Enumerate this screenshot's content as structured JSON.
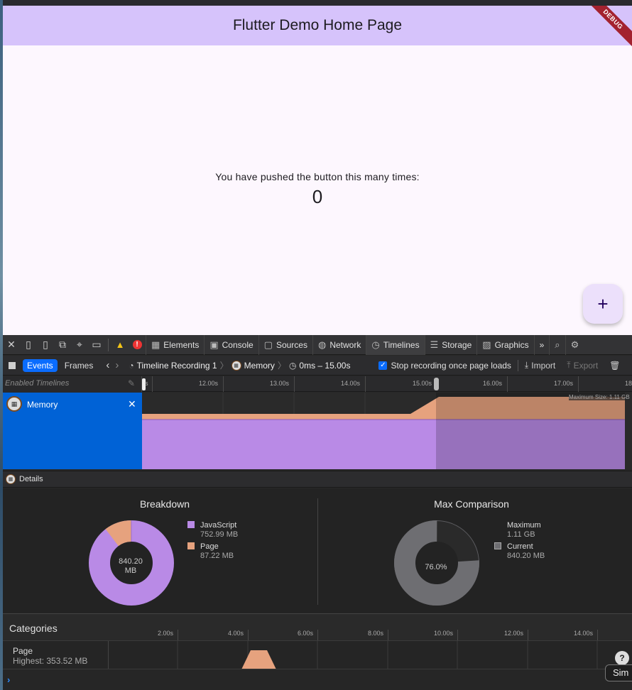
{
  "app": {
    "title": "Flutter Demo Home Page",
    "debug_banner": "DEBUG",
    "counter_label": "You have pushed the button this many times:",
    "counter_value": "0",
    "fab_label": "+"
  },
  "devtools": {
    "tabs": [
      {
        "label": "Elements",
        "icon": "elements-icon"
      },
      {
        "label": "Console",
        "icon": "console-icon"
      },
      {
        "label": "Sources",
        "icon": "sources-icon"
      },
      {
        "label": "Network",
        "icon": "network-icon"
      },
      {
        "label": "Timelines",
        "icon": "timelines-icon",
        "active": true
      },
      {
        "label": "Storage",
        "icon": "storage-icon"
      },
      {
        "label": "Graphics",
        "icon": "graphics-icon"
      }
    ],
    "more_tabs": "»",
    "toolbar": {
      "events_label": "Events",
      "frames_label": "Frames",
      "recording_label": "Timeline Recording 1",
      "memory_label": "Memory",
      "range_label": "0ms – 15.00s",
      "stop_recording_label": "Stop recording once page loads",
      "import_label": "Import",
      "export_label": "Export"
    },
    "ruler": {
      "enabled_label": "Enabled Timelines",
      "ticks": [
        "s",
        "12.00s",
        "13.00s",
        "14.00s",
        "15.00s",
        "16.00s",
        "17.00s",
        "18"
      ]
    },
    "memory_track": {
      "label": "Memory",
      "max_size_label": "Maximum Size: 1.11 GB"
    },
    "details_label": "Details",
    "breakdown": {
      "title": "Breakdown",
      "center_value": "840.20",
      "center_unit": "MB",
      "items": [
        {
          "name": "JavaScript",
          "value": "752.99 MB",
          "color": "#b98ae6"
        },
        {
          "name": "Page",
          "value": "87.22 MB",
          "color": "#e6a27e"
        }
      ]
    },
    "max_comparison": {
      "title": "Max Comparison",
      "center_value": "76.0%",
      "percent": 76.0,
      "items": [
        {
          "name": "Maximum",
          "value": "1.11 GB"
        },
        {
          "name": "Current",
          "value": "840.20 MB",
          "color": "#6e6e72"
        }
      ]
    },
    "categories": {
      "title": "Categories",
      "ticks": [
        "2.00s",
        "4.00s",
        "6.00s",
        "8.00s",
        "10.00s",
        "12.00s",
        "14.00s"
      ],
      "rows": [
        {
          "name": "Page",
          "highest": "Highest: 353.52 MB"
        }
      ]
    },
    "help_label": "?",
    "sim_label": "Sim",
    "colors": {
      "javascript": "#b98ae6",
      "page": "#e6a27e",
      "accent": "#0a6cff"
    }
  }
}
